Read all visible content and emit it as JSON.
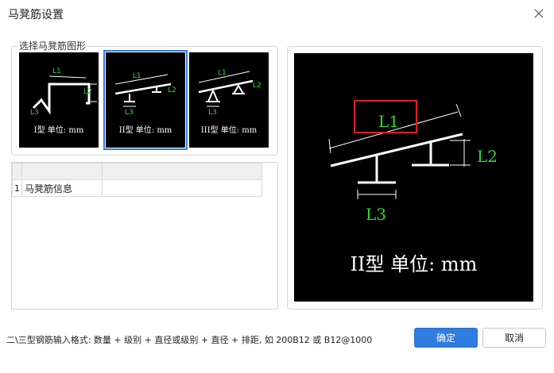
{
  "window": {
    "title": "马凳筋设置"
  },
  "group": {
    "label": "选择马凳筋图形"
  },
  "shapes": [
    {
      "caption": "I型 单位: mm",
      "labels": [
        "L1",
        "L2",
        "L3"
      ],
      "selected": false
    },
    {
      "caption": "II型 单位: mm",
      "labels": [
        "L1",
        "L2",
        "L3"
      ],
      "selected": true
    },
    {
      "caption": "III型 单位: mm",
      "labels": [
        "L1",
        "L2",
        "L3"
      ],
      "selected": false
    }
  ],
  "grid": {
    "headers": [
      "",
      ""
    ],
    "rows": [
      {
        "index": "1",
        "name": "马凳筋信息",
        "value": ""
      }
    ]
  },
  "preview": {
    "caption": "II型 单位: mm",
    "labels": {
      "l1": "L1",
      "l2": "L2",
      "l3": "L3"
    },
    "highlight_color": "#e02020"
  },
  "hint": "二\\三型钢筋输入格式: 数量 + 级别 + 直径或级别 + 直径 + 排距, 如 200B12 或 B12@1000",
  "buttons": {
    "ok": "确定",
    "cancel": "取消"
  },
  "colors": {
    "accent": "#2f7de0",
    "drawing_green": "#2bdc2b"
  }
}
